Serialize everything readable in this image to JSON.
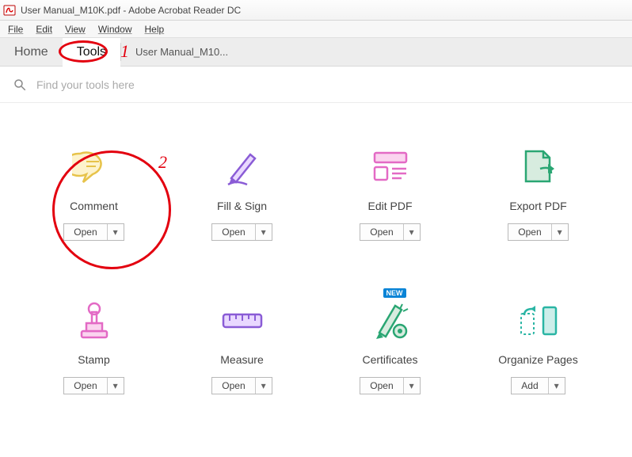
{
  "window": {
    "title": "User Manual_M10K.pdf - Adobe Acrobat Reader DC"
  },
  "menu": {
    "file": "File",
    "edit": "Edit",
    "view": "View",
    "window": "Window",
    "help": "Help"
  },
  "tabs": {
    "home": "Home",
    "tools": "Tools",
    "doc": "User Manual_M10..."
  },
  "search": {
    "placeholder": "Find your tools here"
  },
  "buttons": {
    "open": "Open",
    "add": "Add"
  },
  "badge": {
    "new": "NEW"
  },
  "tools": {
    "comment": "Comment",
    "fillsign": "Fill & Sign",
    "editpdf": "Edit PDF",
    "exportpdf": "Export PDF",
    "stamp": "Stamp",
    "measure": "Measure",
    "certificates": "Certificates",
    "organize": "Organize Pages"
  },
  "annotations": {
    "n1": "1",
    "n2": "2"
  }
}
